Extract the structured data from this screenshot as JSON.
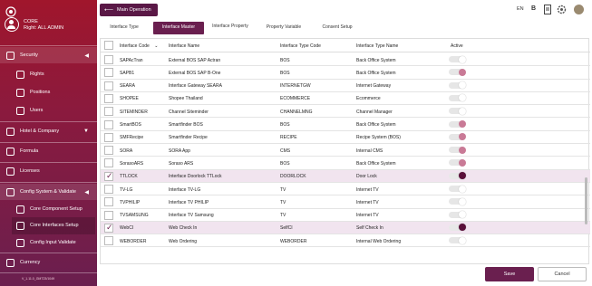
{
  "sidebar": {
    "company": "CORE",
    "right": "Right: ALL ADMIN",
    "items": {
      "security": "Security",
      "rights": "Rights",
      "positions": "Positions",
      "users": "Users",
      "hotel": "Hotel & Company",
      "formula": "Formula",
      "licenses": "Licenses",
      "config": "Config System & Validate",
      "core_component": "Core Component Setup",
      "core_interfaces": "Core Interfaces Setup",
      "config_input": "Config Input Validate",
      "currency": "Currency"
    },
    "version": "V_1.11.0_GMT23/1049"
  },
  "topbar": {
    "main_operation": "Main Operation",
    "lang": "EN",
    "b": "B"
  },
  "tabs": {
    "interface_type": "Interface Type",
    "interface_master": "Interface Master",
    "interface_property": "Interface Property",
    "property_variable": "Property Variable",
    "consent_setup": "Consent Setup"
  },
  "table": {
    "headers": {
      "code": "Interface Code",
      "name": "Interface Name",
      "type_code": "Interface Type Code",
      "type_name": "Interface Type Name",
      "active": "Active"
    },
    "rows": [
      {
        "code": "SAPAcTran",
        "name": "External BOS SAP Actran",
        "type_code": "BOS",
        "type_name": "Back Office System"
      },
      {
        "code": "SAPB1",
        "name": "External BOS SAP B-One",
        "type_code": "BOS",
        "type_name": "Back Office System"
      },
      {
        "code": "SEARA",
        "name": "Interface Gateway SEARA",
        "type_code": "INTERNETGW",
        "type_name": "Internet Gateway"
      },
      {
        "code": "SHOPEE",
        "name": "Shopee Thailand",
        "type_code": "ECOMMERCE",
        "type_name": "Ecommerce"
      },
      {
        "code": "SITEMINDER",
        "name": "Channel Siteminder",
        "type_code": "CHANNELMNG",
        "type_name": "Channel Manager"
      },
      {
        "code": "SmartBOS",
        "name": "Smartfinder BOS",
        "type_code": "BOS",
        "type_name": "Back Office System"
      },
      {
        "code": "SMFRecipe",
        "name": "Smartfinder Recipe",
        "type_code": "RECIPE",
        "type_name": "Recipe System (BOS)"
      },
      {
        "code": "SORA",
        "name": "SORA App",
        "type_code": "CMS",
        "type_name": "Internal CMS"
      },
      {
        "code": "SorasoARS",
        "name": "Soraso ARS",
        "type_code": "BOS",
        "type_name": "Back Office System"
      },
      {
        "code": "TTLOCK",
        "name": "Interface Doorlock TTLock",
        "type_code": "DOORLOCK",
        "type_name": "Door Lock"
      },
      {
        "code": "TV-LG",
        "name": "Interface TV-LG",
        "type_code": "TV",
        "type_name": "Internet TV"
      },
      {
        "code": "TVPHILIP",
        "name": "Interface TV PHILIP",
        "type_code": "TV",
        "type_name": "Internet TV"
      },
      {
        "code": "TVSAMSUNG",
        "name": "Interface TV Samsung",
        "type_code": "TV",
        "type_name": "Internet TV"
      },
      {
        "code": "WebCI",
        "name": "Web Check In",
        "type_code": "SelfCI",
        "type_name": "Self Check In"
      },
      {
        "code": "WEBORDER",
        "name": "Web Ordering",
        "type_code": "WEBORDER",
        "type_name": "Internal Web Ordering"
      }
    ]
  },
  "footer": {
    "save": "Save",
    "cancel": "Cancel"
  },
  "colors": {
    "primary": "#6a1f4f",
    "sidebar_top": "#a0162c",
    "selected_row": "#f1e4ef"
  }
}
